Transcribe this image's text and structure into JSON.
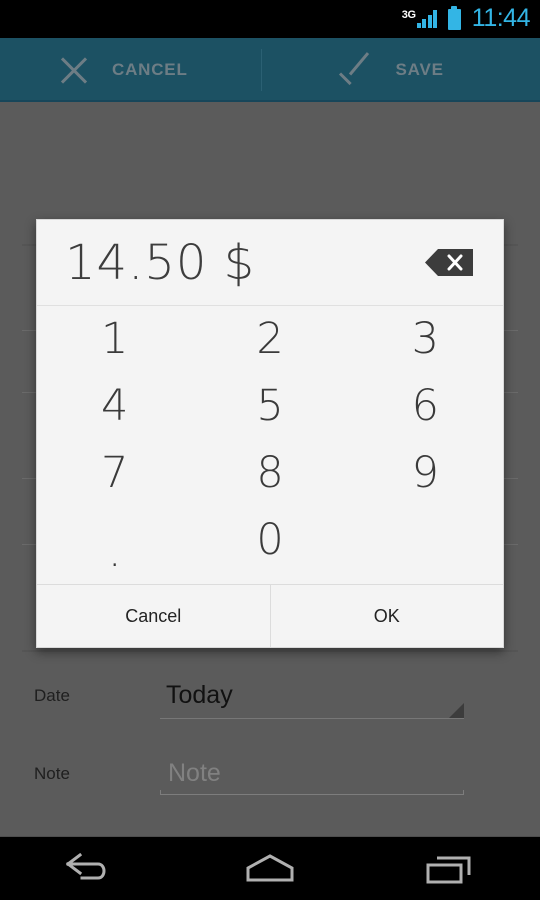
{
  "status_bar": {
    "network_type": "3G",
    "clock": "11:44",
    "signal_icon": "signal-bars-icon",
    "battery_icon": "battery-icon",
    "accent_color": "#33b5e5",
    "background_color": "#000000"
  },
  "action_bar": {
    "background_color": "#1c5163",
    "text_color": "#6d7d85",
    "cancel_label": "CANCEL",
    "cancel_icon": "close-x-icon",
    "save_label": "SAVE",
    "save_icon": "check-icon"
  },
  "background_form": {
    "date_row": {
      "label": "Date",
      "value": "Today",
      "caret_icon": "spinner-caret-icon"
    },
    "note_row": {
      "label": "Note",
      "placeholder": "Note"
    }
  },
  "dialog": {
    "amount": "14.50 $",
    "backspace_icon": "backspace-icon",
    "keypad": [
      [
        "1",
        "2",
        "3"
      ],
      [
        "4",
        "5",
        "6"
      ],
      [
        "7",
        "8",
        "9"
      ],
      [
        ".",
        "0",
        ""
      ]
    ],
    "cancel_button": "Cancel",
    "ok_button": "OK",
    "background_color": "#f4f4f4"
  },
  "nav_bar": {
    "back_icon": "back-arrow-icon",
    "home_icon": "home-icon",
    "recents_icon": "recent-apps-icon",
    "background_color": "#000000"
  }
}
